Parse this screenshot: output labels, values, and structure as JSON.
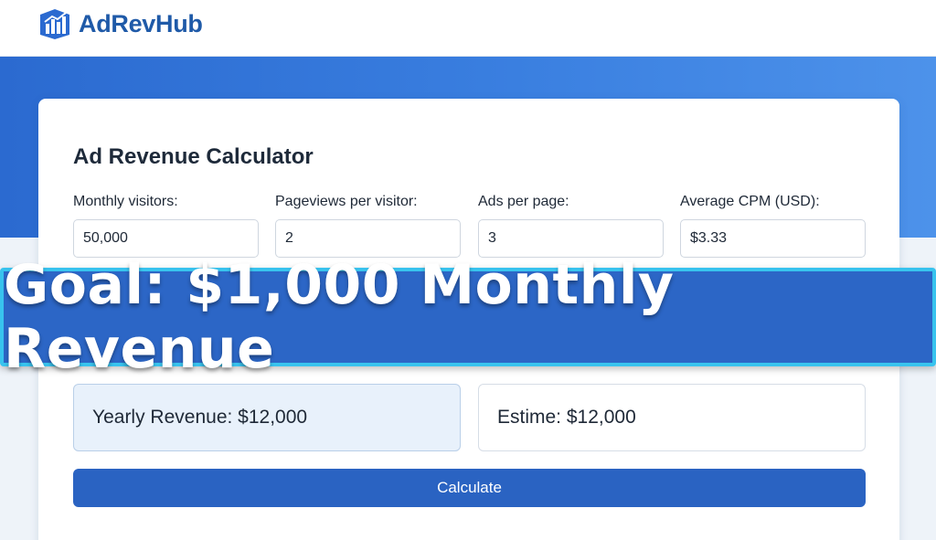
{
  "header": {
    "brand_name": "AdRevHub",
    "logo_icon": "bar-chart-logo-icon"
  },
  "calculator": {
    "title": "Ad Revenue Calculator",
    "fields": [
      {
        "label": "Monthly visitors:",
        "value": "50,000"
      },
      {
        "label": "Pageviews per visitor:",
        "value": "2"
      },
      {
        "label": "Ads per page:",
        "value": "3"
      },
      {
        "label": "Average CPM (USD):",
        "value": "$3.33"
      }
    ],
    "results": {
      "yearly": "Yearly Revenue: $12,000",
      "estimate": "Estime: $12,000"
    },
    "calculate_label": "Calculate"
  },
  "banner": {
    "text": "Goal: $1,000 Monthly Revenue"
  },
  "colors": {
    "brand": "#1f5aa8",
    "hero": "#3a7fe0",
    "button": "#2a63c2",
    "banner": "#2c66c6",
    "banner_border": "#38c3ee"
  }
}
